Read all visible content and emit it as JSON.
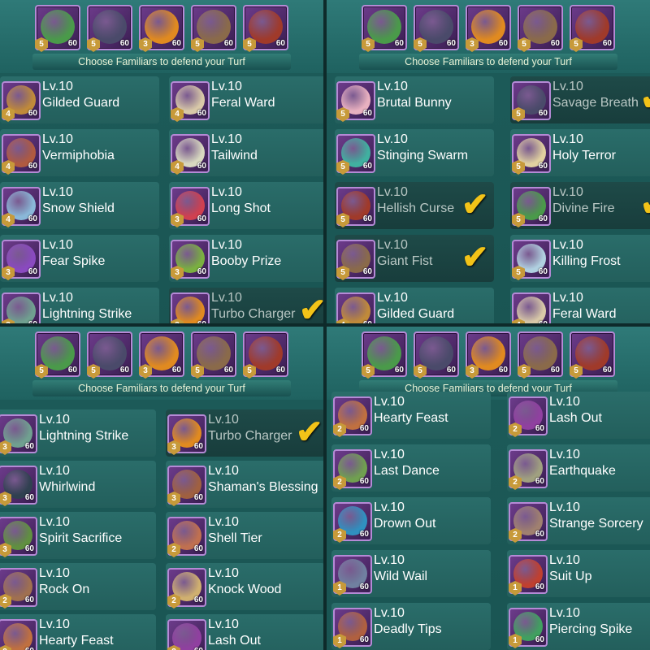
{
  "colors": {
    "accent_check": "#f2c318",
    "panel": "#1d5c5a",
    "frame": "#b58ad6"
  },
  "panels": [
    {
      "banner": "Choose Familiars to defend your Turf",
      "team": [
        {
          "badge": "5",
          "level": "60",
          "icon": "green-dragon-familiar-icon",
          "color": "#4a9a4a"
        },
        {
          "badge": "5",
          "level": "60",
          "icon": "savage-breath-familiar-icon",
          "color": "#4a4a6a"
        },
        {
          "badge": "3",
          "level": "60",
          "icon": "turbo-charger-familiar-icon",
          "color": "#e08a20"
        },
        {
          "badge": "5",
          "level": "60",
          "icon": "giant-fist-familiar-icon",
          "color": "#8a6a4a"
        },
        {
          "badge": "5",
          "level": "60",
          "icon": "hellish-curse-familiar-icon",
          "color": "#a03a2a"
        }
      ],
      "cards": [
        {
          "lv": "Lv.10",
          "name": "Gilded Guard",
          "badge": "4",
          "level": "60",
          "color": "#c08a3a",
          "sel": false,
          "check": false
        },
        {
          "lv": "Lv.10",
          "name": "Feral Ward",
          "badge": "4",
          "level": "60",
          "color": "#d8c8a8",
          "sel": false,
          "check": false
        },
        {
          "lv": "Lv.10",
          "name": "Vermiphobia",
          "badge": "4",
          "level": "60",
          "color": "#b05a40",
          "sel": false,
          "check": false
        },
        {
          "lv": "Lv.10",
          "name": "Tailwind",
          "badge": "4",
          "level": "60",
          "color": "#d8d8c0",
          "sel": false,
          "check": false
        },
        {
          "lv": "Lv.10",
          "name": "Snow Shield",
          "badge": "4",
          "level": "60",
          "color": "#8ab8d8",
          "sel": false,
          "check": false
        },
        {
          "lv": "Lv.10",
          "name": "Long Shot",
          "badge": "3",
          "level": "60",
          "color": "#d04050",
          "sel": false,
          "check": false
        },
        {
          "lv": "Lv.10",
          "name": "Fear Spike",
          "badge": "3",
          "level": "60",
          "color": "#8a4ac0",
          "sel": false,
          "check": false
        },
        {
          "lv": "Lv.10",
          "name": "Booby Prize",
          "badge": "3",
          "level": "60",
          "color": "#7ab040",
          "sel": false,
          "check": false
        },
        {
          "lv": "Lv.10",
          "name": "Lightning Strike",
          "badge": "3",
          "level": "60",
          "color": "#70a090",
          "sel": false,
          "check": false
        },
        {
          "lv": "Lv.10",
          "name": "Turbo Charger",
          "badge": "3",
          "level": "60",
          "color": "#e08a20",
          "sel": true,
          "check": true
        }
      ]
    },
    {
      "banner": "Choose Familiars to defend your Turf",
      "team": [
        {
          "badge": "5",
          "level": "60",
          "icon": "green-dragon-familiar-icon",
          "color": "#4a9a4a"
        },
        {
          "badge": "5",
          "level": "60",
          "icon": "savage-breath-familiar-icon",
          "color": "#4a4a6a"
        },
        {
          "badge": "3",
          "level": "60",
          "icon": "turbo-charger-familiar-icon",
          "color": "#e08a20"
        },
        {
          "badge": "5",
          "level": "60",
          "icon": "giant-fist-familiar-icon",
          "color": "#8a6a4a"
        },
        {
          "badge": "5",
          "level": "60",
          "icon": "hellish-curse-familiar-icon",
          "color": "#a03a2a"
        }
      ],
      "cards": [
        {
          "lv": "Lv.10",
          "name": "Brutal Bunny",
          "badge": "5",
          "level": "60",
          "color": "#e8b0c0",
          "sel": false,
          "check": false
        },
        {
          "lv": "Lv.10",
          "name": "Savage Breath",
          "badge": "5",
          "level": "60",
          "color": "#4a4a6a",
          "sel": true,
          "check": true
        },
        {
          "lv": "Lv.10",
          "name": "Stinging Swarm",
          "badge": "5",
          "level": "60",
          "color": "#40b0a0",
          "sel": false,
          "check": false
        },
        {
          "lv": "Lv.10",
          "name": "Holy Terror",
          "badge": "5",
          "level": "60",
          "color": "#e0d0a0",
          "sel": false,
          "check": false
        },
        {
          "lv": "Lv.10",
          "name": "Hellish Curse",
          "badge": "5",
          "level": "60",
          "color": "#a03a2a",
          "sel": true,
          "check": true
        },
        {
          "lv": "Lv.10",
          "name": "Divine Fire",
          "badge": "5",
          "level": "60",
          "color": "#4a9a4a",
          "sel": true,
          "check": true
        },
        {
          "lv": "Lv.10",
          "name": "Giant Fist",
          "badge": "5",
          "level": "60",
          "color": "#8a6a4a",
          "sel": true,
          "check": true
        },
        {
          "lv": "Lv.10",
          "name": "Killing Frost",
          "badge": "5",
          "level": "60",
          "color": "#b0d0e0",
          "sel": false,
          "check": false
        },
        {
          "lv": "Lv.10",
          "name": "Gilded Guard",
          "badge": "4",
          "level": "60",
          "color": "#c08a3a",
          "sel": false,
          "check": false
        },
        {
          "lv": "Lv.10",
          "name": "Feral Ward",
          "badge": "4",
          "level": "60",
          "color": "#d8c8a8",
          "sel": false,
          "check": false
        }
      ]
    },
    {
      "banner": "Choose Familiars to defend your Turf",
      "team": [
        {
          "badge": "5",
          "level": "60",
          "icon": "green-dragon-familiar-icon",
          "color": "#4a9a4a"
        },
        {
          "badge": "5",
          "level": "60",
          "icon": "savage-breath-familiar-icon",
          "color": "#4a4a6a"
        },
        {
          "badge": "3",
          "level": "60",
          "icon": "turbo-charger-familiar-icon",
          "color": "#e08a20"
        },
        {
          "badge": "5",
          "level": "60",
          "icon": "giant-fist-familiar-icon",
          "color": "#8a6a4a"
        },
        {
          "badge": "5",
          "level": "60",
          "icon": "hellish-curse-familiar-icon",
          "color": "#a03a2a"
        }
      ],
      "cards": [
        {
          "lv": "Lv.10",
          "name": "Lightning Strike",
          "badge": "3",
          "level": "60",
          "color": "#70a090",
          "sel": false,
          "check": false
        },
        {
          "lv": "Lv.10",
          "name": "Turbo Charger",
          "badge": "3",
          "level": "60",
          "color": "#e08a20",
          "sel": true,
          "check": true
        },
        {
          "lv": "Lv.10",
          "name": "Whirlwind",
          "badge": "3",
          "level": "60",
          "color": "#304050",
          "sel": false,
          "check": false
        },
        {
          "lv": "Lv.10",
          "name": "Shaman's Blessing",
          "badge": "3",
          "level": "60",
          "color": "#a06040",
          "sel": false,
          "check": false
        },
        {
          "lv": "Lv.10",
          "name": "Spirit Sacrifice",
          "badge": "3",
          "level": "60",
          "color": "#609040",
          "sel": false,
          "check": false
        },
        {
          "lv": "Lv.10",
          "name": "Shell Tier",
          "badge": "2",
          "level": "60",
          "color": "#c07050",
          "sel": false,
          "check": false
        },
        {
          "lv": "Lv.10",
          "name": "Rock On",
          "badge": "2",
          "level": "60",
          "color": "#a07050",
          "sel": false,
          "check": false
        },
        {
          "lv": "Lv.10",
          "name": "Knock Wood",
          "badge": "2",
          "level": "60",
          "color": "#d0b070",
          "sel": false,
          "check": false
        },
        {
          "lv": "Lv.10",
          "name": "Hearty Feast",
          "badge": "2",
          "level": "60",
          "color": "#c07040",
          "sel": false,
          "check": false
        },
        {
          "lv": "Lv.10",
          "name": "Lash Out",
          "badge": "2",
          "level": "60",
          "color": "#9040a0",
          "sel": false,
          "check": false
        }
      ]
    },
    {
      "banner": "Choose Familiars to defend your Turf",
      "team": [
        {
          "badge": "5",
          "level": "60",
          "icon": "green-dragon-familiar-icon",
          "color": "#4a9a4a"
        },
        {
          "badge": "5",
          "level": "60",
          "icon": "savage-breath-familiar-icon",
          "color": "#4a4a6a"
        },
        {
          "badge": "3",
          "level": "60",
          "icon": "turbo-charger-familiar-icon",
          "color": "#e08a20"
        },
        {
          "badge": "5",
          "level": "60",
          "icon": "giant-fist-familiar-icon",
          "color": "#8a6a4a"
        },
        {
          "badge": "5",
          "level": "60",
          "icon": "hellish-curse-familiar-icon",
          "color": "#a03a2a"
        }
      ],
      "cards": [
        {
          "lv": "Lv.10",
          "name": "Hearty Feast",
          "badge": "2",
          "level": "60",
          "color": "#c07040",
          "sel": false,
          "check": false
        },
        {
          "lv": "Lv.10",
          "name": "Lash Out",
          "badge": "2",
          "level": "60",
          "color": "#9040a0",
          "sel": false,
          "check": false
        },
        {
          "lv": "Lv.10",
          "name": "Last Dance",
          "badge": "2",
          "level": "60",
          "color": "#70a050",
          "sel": false,
          "check": false
        },
        {
          "lv": "Lv.10",
          "name": "Earthquake",
          "badge": "2",
          "level": "60",
          "color": "#a0a080",
          "sel": false,
          "check": false
        },
        {
          "lv": "Lv.10",
          "name": "Drown Out",
          "badge": "2",
          "level": "60",
          "color": "#3090c0",
          "sel": false,
          "check": false
        },
        {
          "lv": "Lv.10",
          "name": "Strange Sorcery",
          "badge": "2",
          "level": "60",
          "color": "#a08070",
          "sel": false,
          "check": false
        },
        {
          "lv": "Lv.10",
          "name": "Wild Wail",
          "badge": "1",
          "level": "60",
          "color": "#7080a0",
          "sel": false,
          "check": false
        },
        {
          "lv": "Lv.10",
          "name": "Suit Up",
          "badge": "1",
          "level": "60",
          "color": "#c04030",
          "sel": false,
          "check": false
        },
        {
          "lv": "Lv.10",
          "name": "Deadly Tips",
          "badge": "1",
          "level": "60",
          "color": "#b06040",
          "sel": false,
          "check": false
        },
        {
          "lv": "Lv.10",
          "name": "Piercing Spike",
          "badge": "1",
          "level": "60",
          "color": "#40a060",
          "sel": false,
          "check": false
        }
      ]
    }
  ]
}
